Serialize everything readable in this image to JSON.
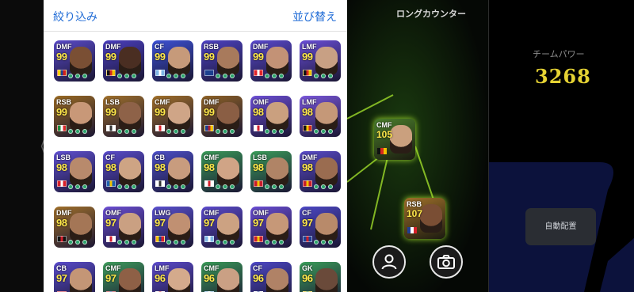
{
  "picker": {
    "filter_label": "絞り込み",
    "sort_label": "並び替え",
    "players": [
      {
        "pos": "DMF",
        "ovr": "99",
        "bg": "#5a4bc9",
        "face": "#7a4f34",
        "flag": [
          "#f6d000",
          "#1d3f94",
          "#d2201a"
        ]
      },
      {
        "pos": "DMF",
        "ovr": "99",
        "bg": "#4b3fbf",
        "face": "#4a2e22",
        "flag": [
          "#111111",
          "#d62a20",
          "#f2c200"
        ]
      },
      {
        "pos": "CF",
        "ovr": "99",
        "bg": "#3d52d6",
        "face": "#c69a7a",
        "flag": [
          "#7fb7e6",
          "#ffffff",
          "#7fb7e6"
        ]
      },
      {
        "pos": "RSB",
        "ovr": "99",
        "bg": "#4e43c4",
        "face": "#a87a5c",
        "flag": [
          "#1b3f8f",
          "#1b3f8f",
          "#1b3f8f"
        ]
      },
      {
        "pos": "DMF",
        "ovr": "99",
        "bg": "#5b4ad0",
        "face": "#c39276",
        "flag": [
          "#e0242a",
          "#ffffff",
          "#e0242a"
        ]
      },
      {
        "pos": "LMF",
        "ovr": "99",
        "bg": "#6a4fd9",
        "face": "#c8a084",
        "flag": [
          "#111111",
          "#d62a20",
          "#f2c200"
        ]
      },
      {
        "pos": "RSB",
        "ovr": "99",
        "bg": "#9a6a22",
        "face": "#c89878",
        "flag": [
          "#1f8a3a",
          "#ffffff",
          "#d82a2a"
        ]
      },
      {
        "pos": "LSB",
        "ovr": "99",
        "bg": "#a0702a",
        "face": "#8e6248",
        "flag": [
          "#ffffff",
          "#333333",
          "#ffffff"
        ]
      },
      {
        "pos": "CMF",
        "ovr": "99",
        "bg": "#a27028",
        "face": "#cfa587",
        "flag": [
          "#ffffff",
          "#d8202a",
          "#ffffff"
        ]
      },
      {
        "pos": "DMF",
        "ovr": "99",
        "bg": "#8f6225",
        "face": "#8a5e44",
        "flag": [
          "#1c3d8f",
          "#b2202c",
          "#f2c200"
        ]
      },
      {
        "pos": "OMF",
        "ovr": "98",
        "bg": "#6d4fd6",
        "face": "#caa07f",
        "flag": [
          "#ffffff",
          "#d22030",
          "#ffffff"
        ]
      },
      {
        "pos": "LMF",
        "ovr": "98",
        "bg": "#7a57dc",
        "face": "#c59878",
        "flag": [
          "#111111",
          "#f2c200",
          "#d62a20"
        ]
      },
      {
        "pos": "LSB",
        "ovr": "98",
        "bg": "#6050d2",
        "face": "#b88a6c",
        "flag": [
          "#d8202a",
          "#ffffff",
          "#d8202a"
        ]
      },
      {
        "pos": "CF",
        "ovr": "98",
        "bg": "#5a4ccc",
        "face": "#cea484",
        "flag": [
          "#1f5fb0",
          "#f2c200",
          "#1f5fb0"
        ]
      },
      {
        "pos": "CB",
        "ovr": "98",
        "bg": "#4d50c8",
        "face": "#c89c7e",
        "flag": [
          "#ffffff",
          "#333333",
          "#ffffff"
        ]
      },
      {
        "pos": "CMF",
        "ovr": "98",
        "bg": "#3a9a58",
        "face": "#d0a486",
        "flag": [
          "#ffffff",
          "#d8202a",
          "#ffffff"
        ]
      },
      {
        "pos": "LSB",
        "ovr": "98",
        "bg": "#3b9d5a",
        "face": "#b08466",
        "flag": [
          "#c81e2a",
          "#f2c200",
          "#c81e2a"
        ]
      },
      {
        "pos": "DMF",
        "ovr": "98",
        "bg": "#5a4cc9",
        "face": "#9a6c50",
        "flag": [
          "#c81e2a",
          "#f2c200",
          "#c81e2a"
        ]
      },
      {
        "pos": "DMF",
        "ovr": "98",
        "bg": "#a0702a",
        "face": "#a47656",
        "flag": [
          "#111111",
          "#d21e2a",
          "#111111"
        ]
      },
      {
        "pos": "OMF",
        "ovr": "97",
        "bg": "#6c4fd4",
        "face": "#caa082",
        "flag": [
          "#ffffff",
          "#d22030",
          "#ffffff"
        ]
      },
      {
        "pos": "LWG",
        "ovr": "97",
        "bg": "#5a50cf",
        "face": "#c09072",
        "flag": [
          "#f2c200",
          "#1f3f94",
          "#d8202a"
        ]
      },
      {
        "pos": "CMF",
        "ovr": "97",
        "bg": "#5c4bcd",
        "face": "#cca282",
        "flag": [
          "#7fb7e6",
          "#ffffff",
          "#7fb7e6"
        ]
      },
      {
        "pos": "OMF",
        "ovr": "97",
        "bg": "#6a4ed5",
        "face": "#c69878",
        "flag": [
          "#c81e2a",
          "#f2c200",
          "#c81e2a"
        ]
      },
      {
        "pos": "CF",
        "ovr": "97",
        "bg": "#4d48c6",
        "face": "#b88a6a",
        "flag": [
          "#1f3f94",
          "#c81e2a",
          "#1f3f94"
        ]
      },
      {
        "pos": "CB",
        "ovr": "97",
        "bg": "#5a4ccc",
        "face": "#c49676",
        "flag": [
          "#d8202a",
          "#d8202a",
          "#d8202a"
        ]
      },
      {
        "pos": "CMF",
        "ovr": "97",
        "bg": "#3f9c5c",
        "face": "#8e6046",
        "flag": [
          "#c81e2a",
          "#1f3f94",
          "#c81e2a"
        ]
      },
      {
        "pos": "LMF",
        "ovr": "96",
        "bg": "#5c4bcd",
        "face": "#d4aa8c",
        "flag": [
          "#ffffff",
          "#d22030",
          "#ffffff"
        ]
      },
      {
        "pos": "CMF",
        "ovr": "96",
        "bg": "#3a9a58",
        "face": "#caa084",
        "flag": [
          "#7fb7e6",
          "#ffffff",
          "#7fb7e6"
        ]
      },
      {
        "pos": "CF",
        "ovr": "96",
        "bg": "#4d48c6",
        "face": "#b08266",
        "flag": [
          "#ffffff",
          "#1f3f94",
          "#ffffff"
        ]
      },
      {
        "pos": "GK",
        "ovr": "96",
        "bg": "#3b9d5a",
        "face": "#6a4a3a",
        "flag": [
          "#f2c200",
          "#1f8a3a",
          "#f2c200"
        ]
      }
    ]
  },
  "field": {
    "title": "ロングカウンター",
    "cards": [
      {
        "pos": "CMF",
        "ovr": "105",
        "bg": "#4a7e2c",
        "face": "#caa07e",
        "flag": [
          "#111111",
          "#d62a20",
          "#f2c200"
        ]
      },
      {
        "pos": "RSB",
        "ovr": "107",
        "bg": "#a0702a",
        "face": "#7a4e34",
        "flag": [
          "#1f3f94",
          "#ffffff",
          "#d8202a"
        ]
      }
    ],
    "player_button_icon": "person-icon",
    "camera_button_icon": "camera-icon"
  },
  "stats": {
    "power_label": "チームパワー",
    "power_value": "3268",
    "auto_label": "自動配置"
  }
}
